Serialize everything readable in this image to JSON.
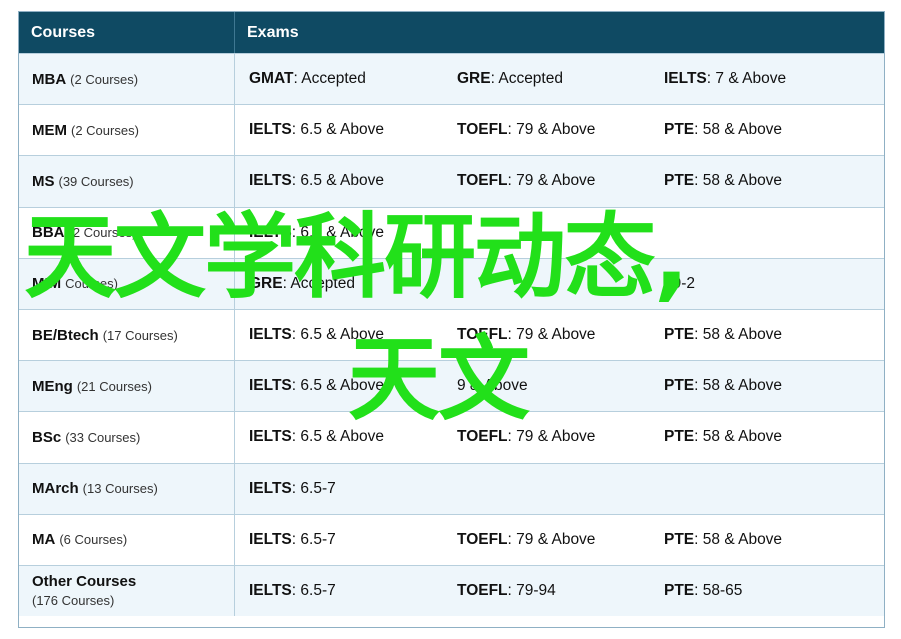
{
  "header": {
    "courses_label": "Courses",
    "exams_label": "Exams"
  },
  "rows": [
    {
      "name": "MBA",
      "count": "(2 Courses)",
      "stack": false,
      "exams": [
        {
          "k": "GMAT",
          "v": ": Accepted"
        },
        {
          "k": "GRE",
          "v": ": Accepted"
        },
        {
          "k": "IELTS",
          "v": ": 7 & Above"
        }
      ]
    },
    {
      "name": "MEM",
      "count": "(2 Courses)",
      "stack": false,
      "exams": [
        {
          "k": "IELTS",
          "v": ": 6.5 & Above"
        },
        {
          "k": "TOEFL",
          "v": ": 79 & Above"
        },
        {
          "k": "PTE",
          "v": ": 58 & Above"
        }
      ]
    },
    {
      "name": "MS",
      "count": "(39 Courses)",
      "stack": false,
      "exams": [
        {
          "k": "IELTS",
          "v": ": 6.5 & Above"
        },
        {
          "k": "TOEFL",
          "v": ": 79 & Above"
        },
        {
          "k": "PTE",
          "v": ": 58 & Above"
        }
      ]
    },
    {
      "name": "BBA",
      "count": "(2 Courses)",
      "stack": false,
      "exams": [
        {
          "k": "IELTS",
          "v": ": 6.5 & Above"
        },
        {
          "k": "",
          "v": ""
        },
        {
          "k": "",
          "v": ""
        }
      ]
    },
    {
      "name": "MIM",
      "count": "Courses)",
      "stack": false,
      "exams": [
        {
          "k": "GRE",
          "v": ": Accepted"
        },
        {
          "k": "",
          "v": ""
        },
        {
          "k": "",
          "v": "79-2"
        }
      ]
    },
    {
      "name": "BE/Btech",
      "count": "(17 Courses)",
      "stack": false,
      "exams": [
        {
          "k": "IELTS",
          "v": ": 6.5 & Above"
        },
        {
          "k": "TOEFL",
          "v": ": 79 & Above"
        },
        {
          "k": "PTE",
          "v": ": 58 & Above"
        }
      ]
    },
    {
      "name": "MEng",
      "count": "(21 Courses)",
      "stack": false,
      "exams": [
        {
          "k": "IELTS",
          "v": ": 6.5 & Above"
        },
        {
          "k": "",
          "v": "9 & Above"
        },
        {
          "k": "PTE",
          "v": ": 58 & Above"
        }
      ]
    },
    {
      "name": "BSc",
      "count": "(33 Courses)",
      "stack": false,
      "exams": [
        {
          "k": "IELTS",
          "v": ": 6.5 & Above"
        },
        {
          "k": "TOEFL",
          "v": ": 79 & Above"
        },
        {
          "k": "PTE",
          "v": ": 58 & Above"
        }
      ]
    },
    {
      "name": "MArch",
      "count": "(13 Courses)",
      "stack": false,
      "exams": [
        {
          "k": "IELTS",
          "v": ": 6.5-7"
        },
        {
          "k": "",
          "v": ""
        },
        {
          "k": "",
          "v": ""
        }
      ]
    },
    {
      "name": "MA",
      "count": "(6 Courses)",
      "stack": false,
      "exams": [
        {
          "k": "IELTS",
          "v": ": 6.5-7"
        },
        {
          "k": "TOEFL",
          "v": ": 79 & Above"
        },
        {
          "k": "PTE",
          "v": ": 58 & Above"
        }
      ]
    },
    {
      "name": "Other Courses",
      "count": "(176 Courses)",
      "stack": true,
      "exams": [
        {
          "k": "IELTS",
          "v": ": 6.5-7"
        },
        {
          "k": "TOEFL",
          "v": ": 79-94"
        },
        {
          "k": "PTE",
          "v": ": 58-65"
        }
      ]
    }
  ],
  "overlay": {
    "line1": "天文学科研动态,",
    "line2": "天文"
  },
  "colors": {
    "header_bg": "#0f4a63",
    "row_alt": "#eef6fb",
    "overlay_text": "#22e01a",
    "border": "#b7cfdd"
  }
}
